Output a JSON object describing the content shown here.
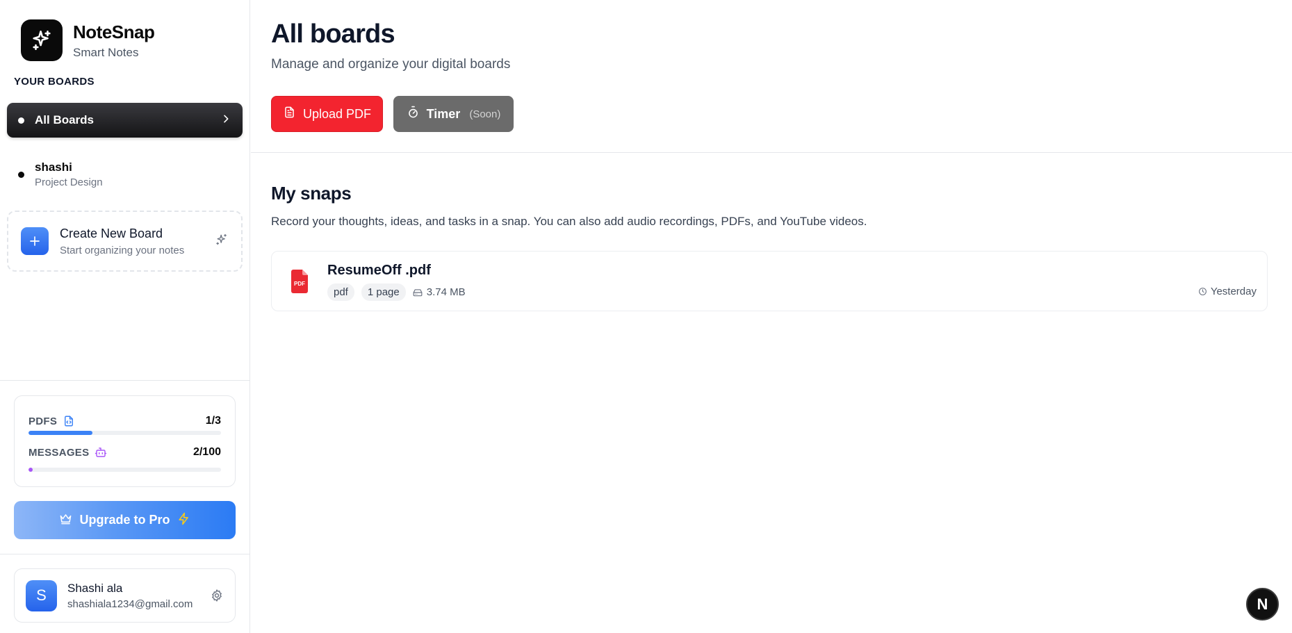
{
  "brand": {
    "name": "NoteSnap",
    "tagline": "Smart Notes",
    "logo_icon": "sparkles-icon"
  },
  "sidebar": {
    "section_label": "YOUR BOARDS",
    "boards": [
      {
        "label": "All Boards",
        "active": true
      },
      {
        "label": "shashi",
        "subtitle": "Project Design",
        "active": false
      }
    ],
    "create_board": {
      "title": "Create New Board",
      "subtitle": "Start organizing your notes",
      "icon": "plus-icon"
    },
    "usage": {
      "pdfs": {
        "label": "PDFS",
        "value": "1/3",
        "fraction": 0.3333,
        "color": "#3b82f6",
        "icon": "file-code-icon"
      },
      "messages": {
        "label": "MESSAGES",
        "value": "2/100",
        "fraction": 0.02,
        "color": "#a855f7",
        "icon": "bot-icon"
      }
    },
    "upgrade": {
      "label": "Upgrade to Pro",
      "icon_left": "crown-icon",
      "icon_right": "zap-icon"
    },
    "user": {
      "initial": "S",
      "name": "Shashi ala",
      "email": "shashiala1234@gmail.com",
      "settings_icon": "gear-icon"
    }
  },
  "main": {
    "title": "All boards",
    "subtitle": "Manage and organize your digital boards",
    "actions": {
      "upload": {
        "label": "Upload PDF",
        "icon": "file-text-icon",
        "color": "#f3242f"
      },
      "timer": {
        "label": "Timer",
        "badge": "(Soon)",
        "icon": "timer-icon"
      }
    },
    "snaps_section": {
      "title": "My snaps",
      "description": "Record your thoughts, ideas, and tasks in a snap. You can also add audio recordings, PDFs, and YouTube videos."
    },
    "snaps": [
      {
        "title": "ResumeOff .pdf",
        "type": "pdf",
        "pages": "1 page",
        "size": "3.74 MB",
        "time": "Yesterday",
        "icon_label": "PDF"
      }
    ]
  },
  "dev_badge": {
    "label": "N"
  }
}
